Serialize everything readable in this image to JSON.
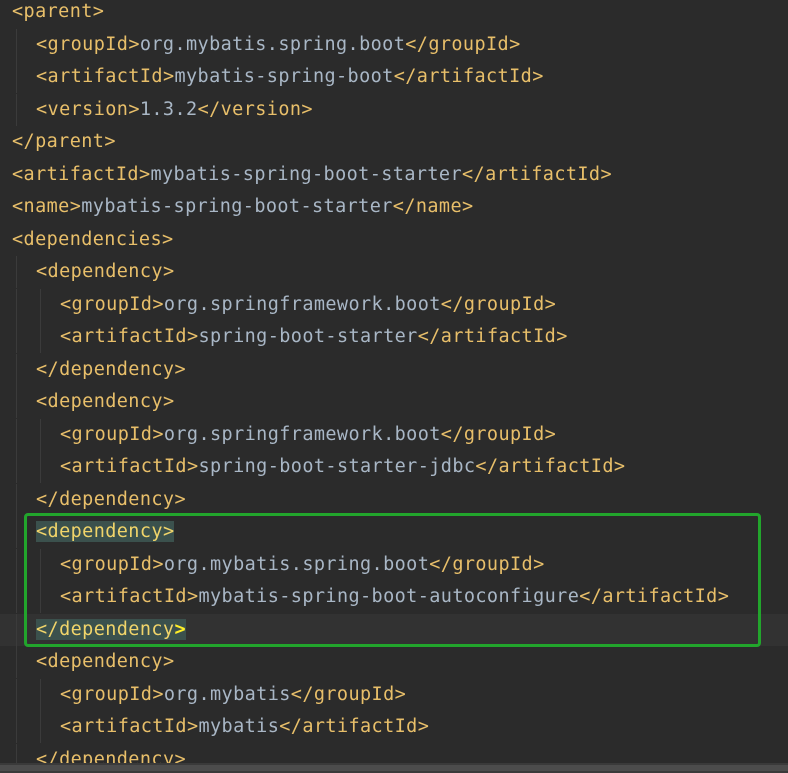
{
  "editor": {
    "lines": [
      {
        "indent": 0,
        "open": "parent",
        "text": null,
        "close": null
      },
      {
        "indent": 1,
        "open": "groupId",
        "text": "org.mybatis.spring.boot",
        "close": "groupId"
      },
      {
        "indent": 1,
        "open": "artifactId",
        "text": "mybatis-spring-boot",
        "close": "artifactId"
      },
      {
        "indent": 1,
        "open": "version",
        "text": "1.3.2",
        "close": "version"
      },
      {
        "indent": 0,
        "open": null,
        "text": null,
        "close": "parent"
      },
      {
        "indent": 0,
        "open": "artifactId",
        "text": "mybatis-spring-boot-starter",
        "close": "artifactId"
      },
      {
        "indent": 0,
        "open": "name",
        "text": "mybatis-spring-boot-starter",
        "close": "name"
      },
      {
        "indent": 0,
        "open": "dependencies",
        "text": null,
        "close": null
      },
      {
        "indent": 1,
        "open": "dependency",
        "text": null,
        "close": null
      },
      {
        "indent": 2,
        "open": "groupId",
        "text": "org.springframework.boot",
        "close": "groupId"
      },
      {
        "indent": 2,
        "open": "artifactId",
        "text": "spring-boot-starter",
        "close": "artifactId"
      },
      {
        "indent": 1,
        "open": null,
        "text": null,
        "close": "dependency"
      },
      {
        "indent": 1,
        "open": "dependency",
        "text": null,
        "close": null
      },
      {
        "indent": 2,
        "open": "groupId",
        "text": "org.springframework.boot",
        "close": "groupId"
      },
      {
        "indent": 2,
        "open": "artifactId",
        "text": "spring-boot-starter-jdbc",
        "close": "artifactId"
      },
      {
        "indent": 1,
        "open": null,
        "text": null,
        "close": "dependency"
      },
      {
        "indent": 1,
        "open": "dependency",
        "text": null,
        "close": null,
        "match": true
      },
      {
        "indent": 2,
        "open": "groupId",
        "text": "org.mybatis.spring.boot",
        "close": "groupId"
      },
      {
        "indent": 2,
        "open": "artifactId",
        "text": "mybatis-spring-boot-autoconfigure",
        "close": "artifactId"
      },
      {
        "indent": 1,
        "open": null,
        "text": null,
        "close": "dependency",
        "match": true,
        "current": true
      },
      {
        "indent": 1,
        "open": "dependency",
        "text": null,
        "close": null
      },
      {
        "indent": 2,
        "open": "groupId",
        "text": "org.mybatis",
        "close": "groupId"
      },
      {
        "indent": 2,
        "open": "artifactId",
        "text": "mybatis",
        "close": "artifactId"
      },
      {
        "indent": 1,
        "open": null,
        "text": null,
        "close": "dependency"
      }
    ]
  },
  "colors": {
    "background": "#2b2b2b",
    "tag": "#e8bf6a",
    "text": "#a9b7c6",
    "annotation_box": "#22a52c"
  }
}
